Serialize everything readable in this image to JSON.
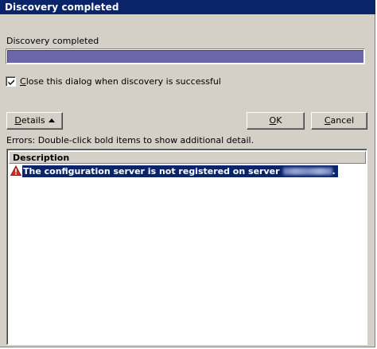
{
  "window": {
    "title": "Discovery completed"
  },
  "status": {
    "label": "Discovery completed",
    "progress_fraction": 1.0,
    "progress_color": "#6b67a8"
  },
  "close_option": {
    "checked": true,
    "label_prefix": "",
    "label_accel": "C",
    "label_rest": "lose this dialog when discovery is successful"
  },
  "buttons": {
    "details_accel": "D",
    "details_rest": "etails",
    "ok_accel": "O",
    "ok_rest": "K",
    "cancel_accel": "C",
    "cancel_rest": "ancel"
  },
  "errors": {
    "label": "Errors: Double-click bold items to show additional detail.",
    "column_header": "Description",
    "items": [
      {
        "text": "The configuration server is not registered on server",
        "icon": "warning-icon",
        "trailing": "."
      }
    ]
  },
  "colors": {
    "titlebar": "#0a246a",
    "selection": "#0a246a",
    "dialog_face": "#d4d0c8"
  }
}
